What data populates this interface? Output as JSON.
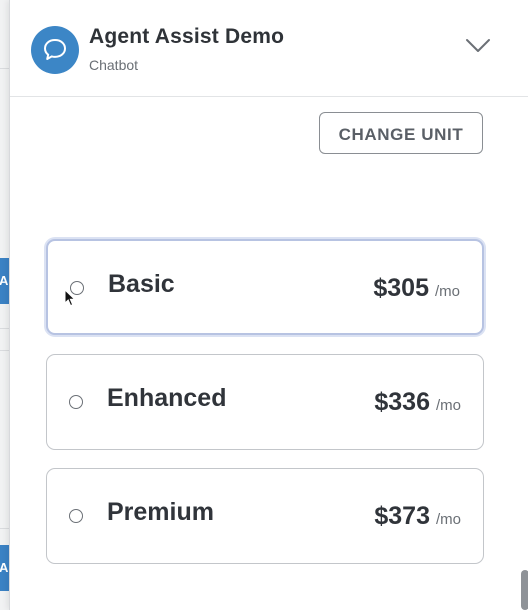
{
  "header": {
    "title": "Agent Assist Demo",
    "subtitle": "Chatbot",
    "avatar_icon": "chat-bubble-icon",
    "collapse_icon": "chevron-down-icon"
  },
  "actions": {
    "change_unit_label": "CHANGE UNIT"
  },
  "plans": [
    {
      "name": "Basic",
      "price": "$305",
      "unit": "/mo",
      "selected": true
    },
    {
      "name": "Enhanced",
      "price": "$336",
      "unit": "/mo",
      "selected": false
    },
    {
      "name": "Premium",
      "price": "$373",
      "unit": "/mo",
      "selected": false
    }
  ],
  "background": {
    "tab_text": "A"
  },
  "colors": {
    "accent": "#3c86c6",
    "selected_border": "#b7c3e2"
  }
}
